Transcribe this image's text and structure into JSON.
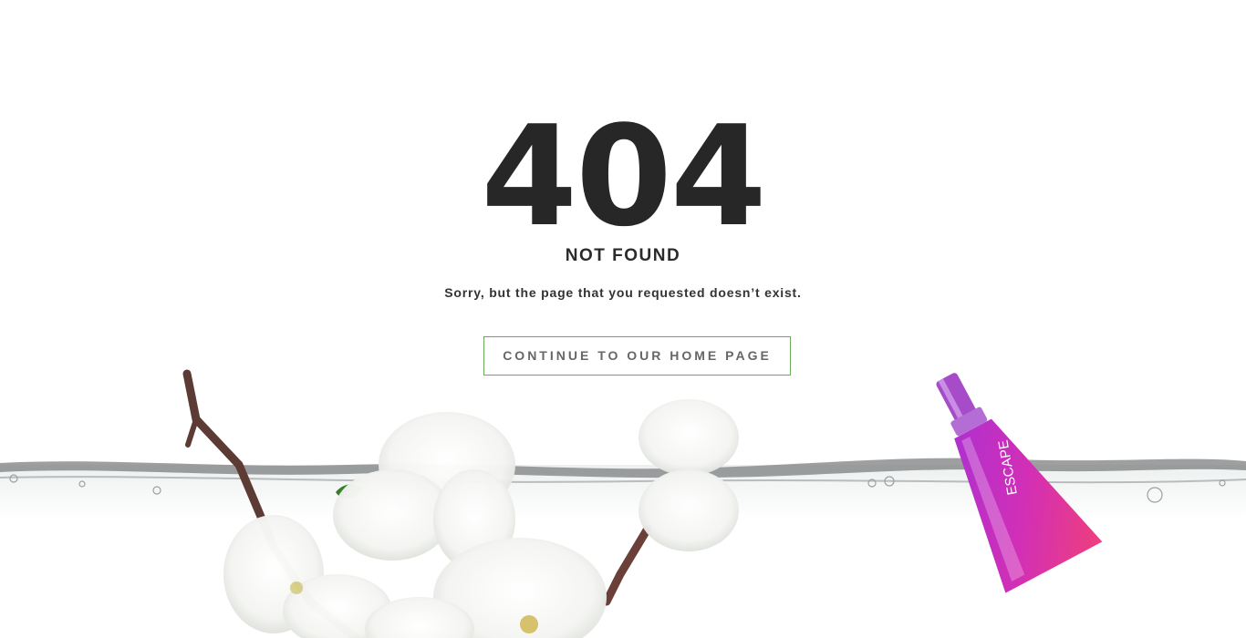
{
  "error": {
    "code": "404",
    "title": "NOT FOUND",
    "message": "Sorry, but the page that you requested doesn’t exist."
  },
  "actions": {
    "home_button_label": "CONTINUE TO OUR HOME PAGE"
  },
  "decoration": {
    "bottle_brand_text": "ESCAPE",
    "accent_color": "#6aab57"
  }
}
